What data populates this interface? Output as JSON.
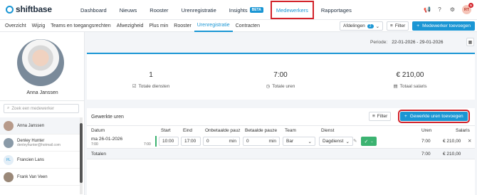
{
  "brand": {
    "name": "shiftbase",
    "accent": "#1a96d4",
    "highlight": "#d3222a"
  },
  "nav": {
    "items": [
      {
        "label": "Dashboard"
      },
      {
        "label": "Nieuws"
      },
      {
        "label": "Rooster"
      },
      {
        "label": "Urenregistratie"
      },
      {
        "label": "Insights",
        "badge": "BETA"
      },
      {
        "label": "Medewerkers"
      },
      {
        "label": "Rapportages"
      }
    ],
    "active_index": 5,
    "user_initials": "RT",
    "notification_count": "5"
  },
  "subnav": {
    "items": [
      "Overzicht",
      "Wijzig",
      "Teams en toegangsrechten",
      "Afwezigheid",
      "Plus min",
      "Rooster",
      "Urenregistratie",
      "Contracten"
    ],
    "active_index": 6,
    "departments_label": "Afdelingen",
    "departments_count": "2",
    "filter_label": "Filter",
    "add_employee_label": "Medewerker toevoegen"
  },
  "sidebar": {
    "employee_name": "Anna Janssen",
    "search_placeholder": "Zoek een medewerker",
    "employees": [
      {
        "name": "Anna Janssen",
        "email": ""
      },
      {
        "name": "Denley Hunter",
        "email": "denleyhunter@hotmail.com"
      },
      {
        "name": "Francien Lans",
        "email": "",
        "initials": "FL"
      },
      {
        "name": "Frank Van Veen",
        "email": ""
      }
    ]
  },
  "period": {
    "label": "Periode:",
    "value": "22-01-2026 - 29-01-2026"
  },
  "stats": [
    {
      "value": "1",
      "label": "Totale diensten",
      "icon": "check-square-icon"
    },
    {
      "value": "7:00",
      "label": "Totale uren",
      "icon": "clock-icon"
    },
    {
      "value": "€ 210,00",
      "label": "Totaal salaris",
      "icon": "wallet-icon"
    }
  ],
  "worked_hours": {
    "title": "Gewerkte uren",
    "filter_label": "Filter",
    "add_label": "Gewerkte uren toevoegen",
    "columns": [
      "Datum",
      "Start",
      "Eind",
      "Onbetaalde pauz",
      "Betaalde pauze",
      "Team",
      "Dienst",
      "Uren",
      "Salaris"
    ],
    "row": {
      "date": "ma 26-01-2026",
      "sched_start": "7:00",
      "sched_end": "7:00",
      "start": "10:00",
      "end": "17:00",
      "unpaid_break": "0",
      "paid_break": "0",
      "unit": "min",
      "team": "Bar",
      "shift": "Dagdienst",
      "hours": "7:00",
      "salary": "€ 210,00"
    },
    "totals": {
      "label": "Totalen",
      "hours": "7:00",
      "salary": "€ 210,00"
    }
  }
}
